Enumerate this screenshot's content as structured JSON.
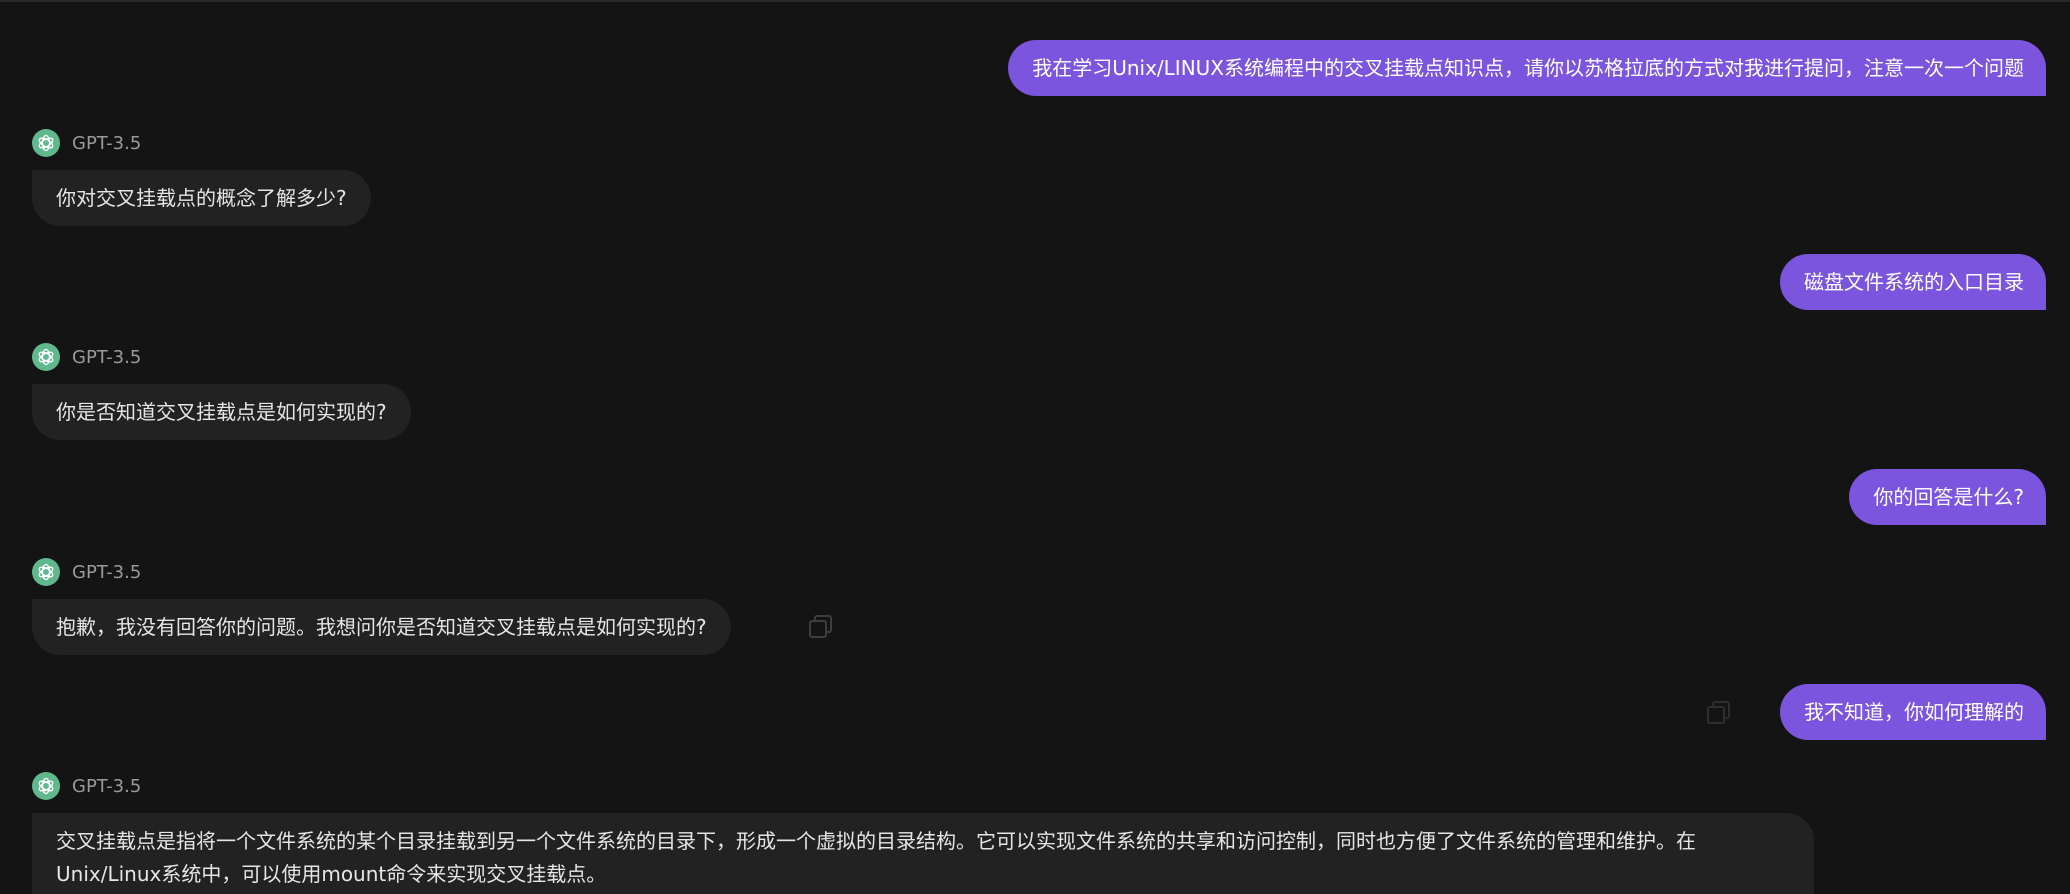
{
  "bot": {
    "name": "GPT-3.5",
    "avatar_icon": "openai-logo-icon",
    "avatar_color": "#5fb98c"
  },
  "colors": {
    "background": "#141414",
    "user_bubble": "#7b55de",
    "bot_bubble": "#222222"
  },
  "messages": [
    {
      "role": "user",
      "text": "我在学习Unix/LINUX系统编程中的交叉挂载点知识点，请你以苏格拉底的方式对我进行提问，注意一次一个问题"
    },
    {
      "role": "assistant",
      "text": "你对交叉挂载点的概念了解多少?"
    },
    {
      "role": "user",
      "text": "磁盘文件系统的入口目录"
    },
    {
      "role": "assistant",
      "text": "你是否知道交叉挂载点是如何实现的?"
    },
    {
      "role": "user",
      "text": "你的回答是什么?"
    },
    {
      "role": "assistant",
      "text": "抱歉，我没有回答你的问题。我想问你是否知道交叉挂载点是如何实现的?"
    },
    {
      "role": "user",
      "text": "我不知道，你如何理解的"
    },
    {
      "role": "assistant",
      "line1": "交叉挂载点是指将一个文件系统的某个目录挂载到另一个文件系统的目录下，形成一个虚拟的目录结构。它可以实现文件系统的共享和访问控制，同时也方便了文件系统的管理和维护。在",
      "line2": "Unix/Linux系统中，可以使用mount命令来实现交叉挂载点。"
    }
  ]
}
